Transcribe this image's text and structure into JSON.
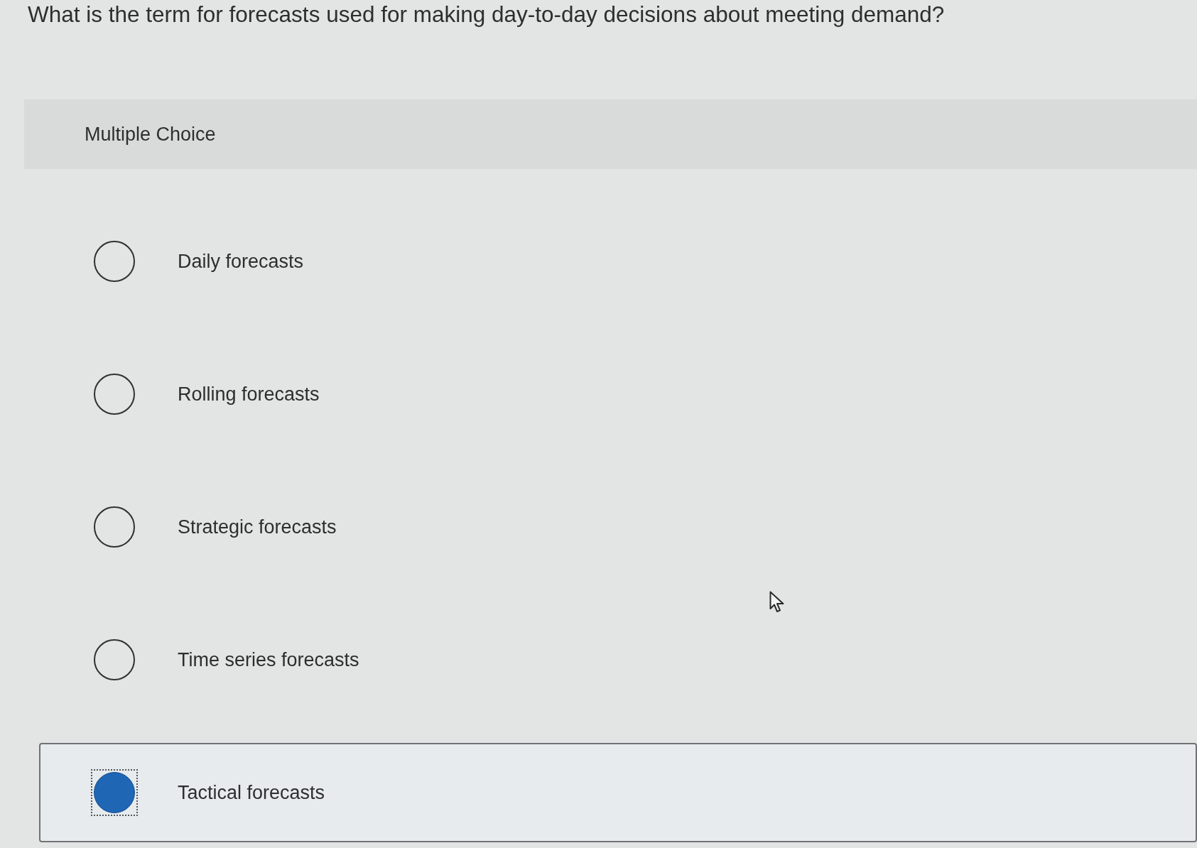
{
  "question": {
    "text": "What is the term for forecasts used for making day-to-day decisions about meeting demand?"
  },
  "question_type": {
    "label": "Multiple Choice"
  },
  "options": [
    {
      "label": "Daily forecasts",
      "selected": false,
      "focused": false
    },
    {
      "label": "Rolling forecasts",
      "selected": false,
      "focused": false
    },
    {
      "label": "Strategic forecasts",
      "selected": false,
      "focused": false
    },
    {
      "label": "Time series forecasts",
      "selected": false,
      "focused": false
    },
    {
      "label": "Tactical forecasts",
      "selected": true,
      "focused": true
    }
  ]
}
